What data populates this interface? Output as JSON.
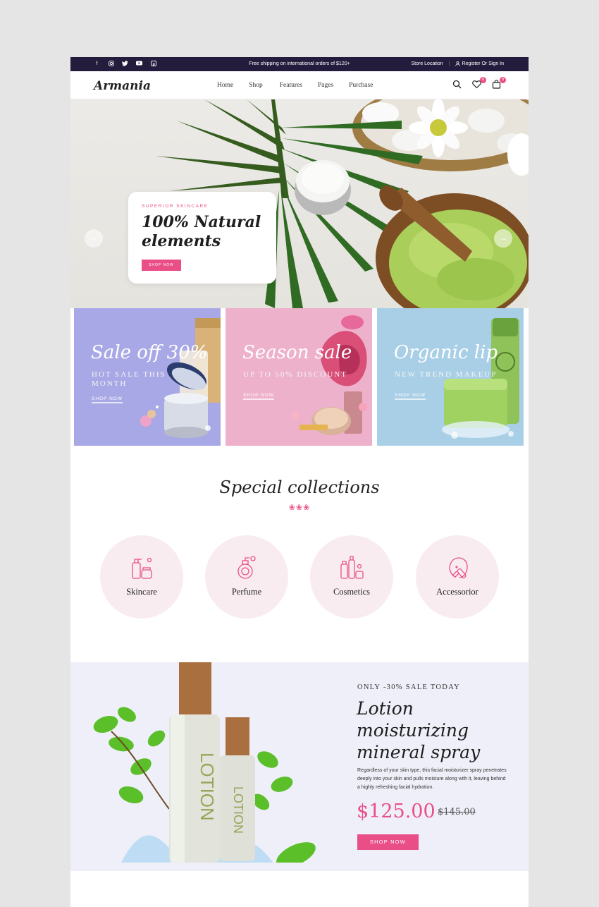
{
  "topbar": {
    "social": [
      "facebook-icon",
      "instagram-icon",
      "twitter-icon",
      "youtube-icon",
      "pinterest-icon"
    ],
    "shipping": "Free shipping on international orders of $120+",
    "store_location": "Store Location",
    "separator": "|",
    "account": "Register Or Sign In"
  },
  "header": {
    "logo": "Armania",
    "nav": [
      "Home",
      "Shop",
      "Features",
      "Pages",
      "Purchase"
    ],
    "wishlist_count": "0",
    "cart_count": "0"
  },
  "hero": {
    "kicker": "SUPERIOR SKINCARE",
    "title_line1": "100% Natural",
    "title_line2": "elements",
    "button": "SHOP NOW",
    "prev": "←",
    "next": "→"
  },
  "banners": [
    {
      "title": "Sale off 30%",
      "sub_line1": "HOT SALE THIS",
      "sub_line2": "MONTH",
      "button": "SHOP NOW"
    },
    {
      "title": "Season sale",
      "sub_line1": "UP TO 50% DISCOUNT",
      "sub_line2": "",
      "button": "SHOP NOW"
    },
    {
      "title": "Organic lip",
      "sub_line1": "NEW TREND MAKEUP",
      "sub_line2": "",
      "button": "SHOP NOW"
    }
  ],
  "collections": {
    "title": "Special collections",
    "flowers": "❀❀❀",
    "items": [
      "Skincare",
      "Perfume",
      "Cosmetics",
      "Accessorior"
    ]
  },
  "promo": {
    "kicker": "ONLY -30% SALE TODAY",
    "title_line1": "Lotion",
    "title_line2": "moisturizing",
    "title_line3": "mineral spray",
    "description": "Regardless of your skin type, this facial moisturizer spray penetrates deeply into your skin and pulls moisture along with it, leaving behind a highly refreshing facial hydration.",
    "price": "$125.00",
    "old_price": "$145.00",
    "button": "SHOP NOW",
    "bottle_text": "LOTION"
  },
  "colors": {
    "accent": "#e94f86",
    "topbar": "#241c3c",
    "banner_purple": "#a9a8e6",
    "banner_pink": "#eeb1cb",
    "banner_blue": "#a9cfe6"
  }
}
